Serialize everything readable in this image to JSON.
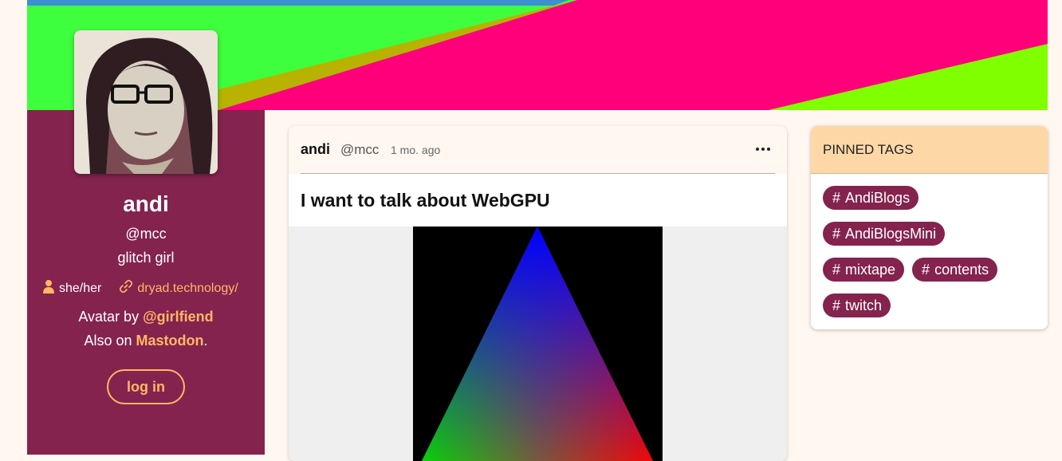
{
  "profile": {
    "name": "andi",
    "handle": "@mcc",
    "bio": "glitch girl",
    "pronouns": "she/her",
    "website": "dryad.technology/",
    "avatar_credit_prefix": "Avatar by ",
    "avatar_credit_user": "@girlfiend",
    "also_prefix": "Also on ",
    "also_site": "Mastodon",
    "also_suffix": ".",
    "login_label": "log in"
  },
  "post": {
    "author": "andi",
    "handle": "@mcc",
    "time": "1 mo. ago",
    "title": "I want to talk about WebGPU"
  },
  "pinned": {
    "title": "PINNED TAGS",
    "hash": "#",
    "tags": [
      "AndiBlogs",
      "AndiBlogsMini",
      "mixtape",
      "contents",
      "twitch"
    ]
  },
  "colors": {
    "page_bg": "#fff7f0",
    "sidebar_bg": "#84234e",
    "accent": "#ffb866",
    "pinned_header_bg": "#fdd8a6",
    "banner_pink": "#ff007a",
    "banner_green": "#3dff3d",
    "banner_lime": "#80ff00"
  },
  "icons": {
    "pronoun": "person-icon",
    "website": "link-icon",
    "options": "more-dots-icon"
  }
}
